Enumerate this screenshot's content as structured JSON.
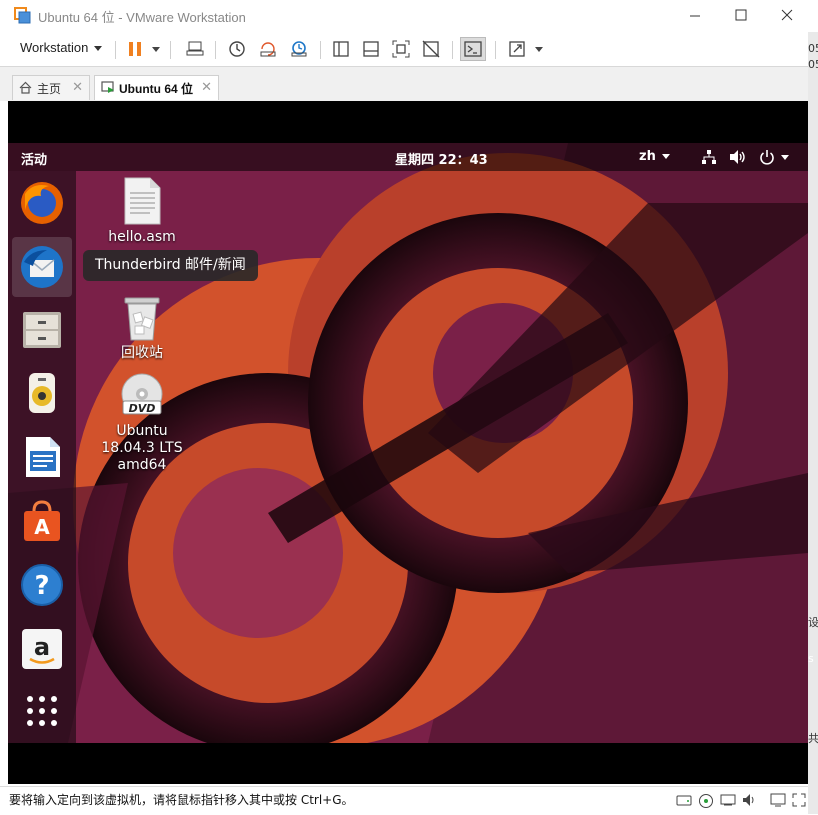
{
  "window": {
    "title": "Ubuntu 64 位 - VMware Workstation"
  },
  "toolbar": {
    "workstation_menu": "Workstation"
  },
  "tabs": [
    {
      "label": "主页",
      "icon": "home-icon",
      "active": false
    },
    {
      "label": "Ubuntu 64 位",
      "icon": "vm-icon",
      "active": true
    }
  ],
  "right_strip_fragments": [
    "05",
    "05",
    "设",
    "s",
    "共"
  ],
  "vm": {
    "topbar": {
      "activities": "活动",
      "clock": "星期四 22：43",
      "language": "zh"
    },
    "dock": {
      "items": [
        "firefox-icon",
        "thunderbird-icon",
        "files-icon",
        "rhythmbox-icon",
        "libreoffice-writer-icon",
        "software-center-icon",
        "help-icon",
        "amazon-icon",
        "show-apps-icon"
      ],
      "tooltip": "Thunderbird 邮件/新闻"
    },
    "desktop_icons": [
      {
        "label": "hello.asm",
        "icon": "text-file-icon"
      },
      {
        "label": "回收站",
        "icon": "trash-icon"
      },
      {
        "label": "Ubuntu\n18.04.3 LTS\namd64",
        "label_lines": [
          "Ubuntu",
          "18.04.3 LTS",
          "amd64"
        ],
        "icon": "dvd-icon"
      }
    ]
  },
  "statusbar": {
    "text": "要将输入定向到该虚拟机，请将鼠标指针移入其中或按 Ctrl+G。"
  },
  "colors": {
    "accent_pause": "#f08020",
    "wallpaper_base": "#7a2048",
    "wallpaper_orange": "#e0582c"
  }
}
